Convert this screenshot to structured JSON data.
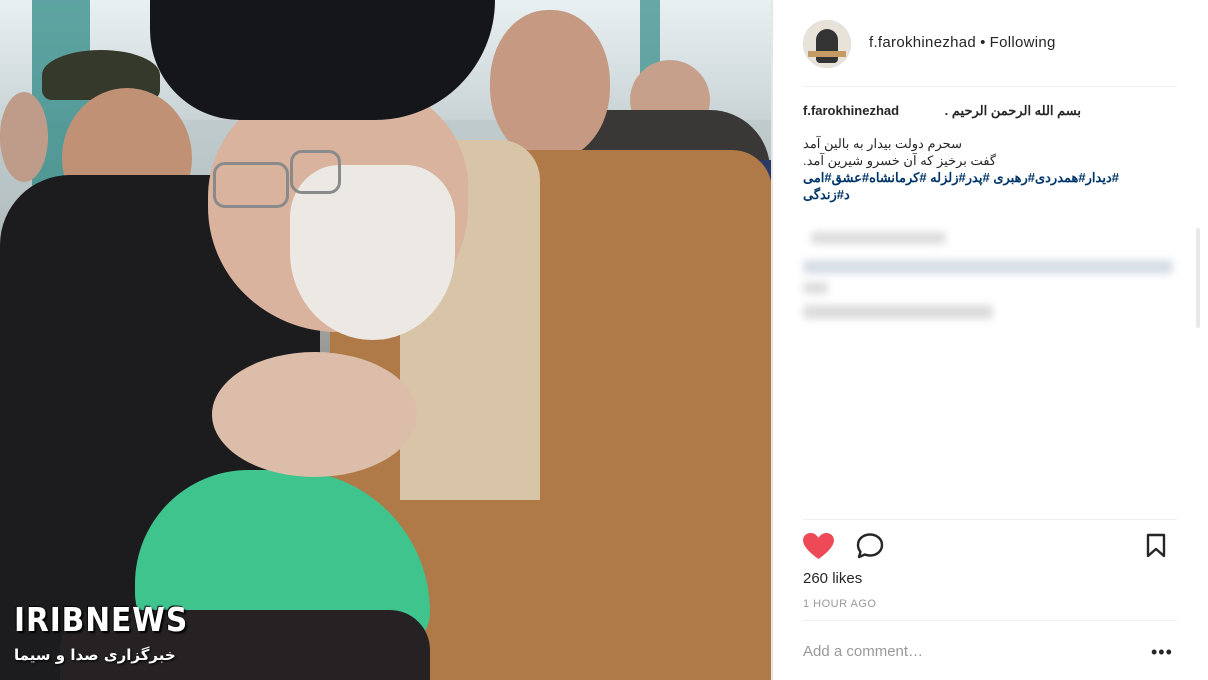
{
  "photo": {
    "watermark_brand": "IRIBNEWS",
    "watermark_subtitle": "خبرگزاری صدا و سیما"
  },
  "post": {
    "username": "f.farokhinezhad",
    "separator": "•",
    "follow_status": "Following",
    "caption": {
      "line1": "بسم الله الرحمن الرحيم .",
      "line2": "سحرم دولت بیدار به بالین آمد",
      "line3": "گفت برخیز که آن خسرو شیرین آمد.",
      "hashtags_line1": "#دیدار#همدردی#رهبری  #پدر#زلزله #کرمانشاه#عشق#امی",
      "hashtags_line2": "د#زندگی"
    },
    "likes": "260 likes",
    "timestamp": "1 HOUR AGO",
    "comment_placeholder": "Add a comment…",
    "more_label": "•••"
  },
  "icons": {
    "like": "heart-icon",
    "comment": "comment-icon",
    "save": "bookmark-icon",
    "more": "more-icon"
  },
  "colors": {
    "heart": "#ed4956",
    "hashtag": "#003569",
    "text": "#262626",
    "muted": "#999999"
  }
}
